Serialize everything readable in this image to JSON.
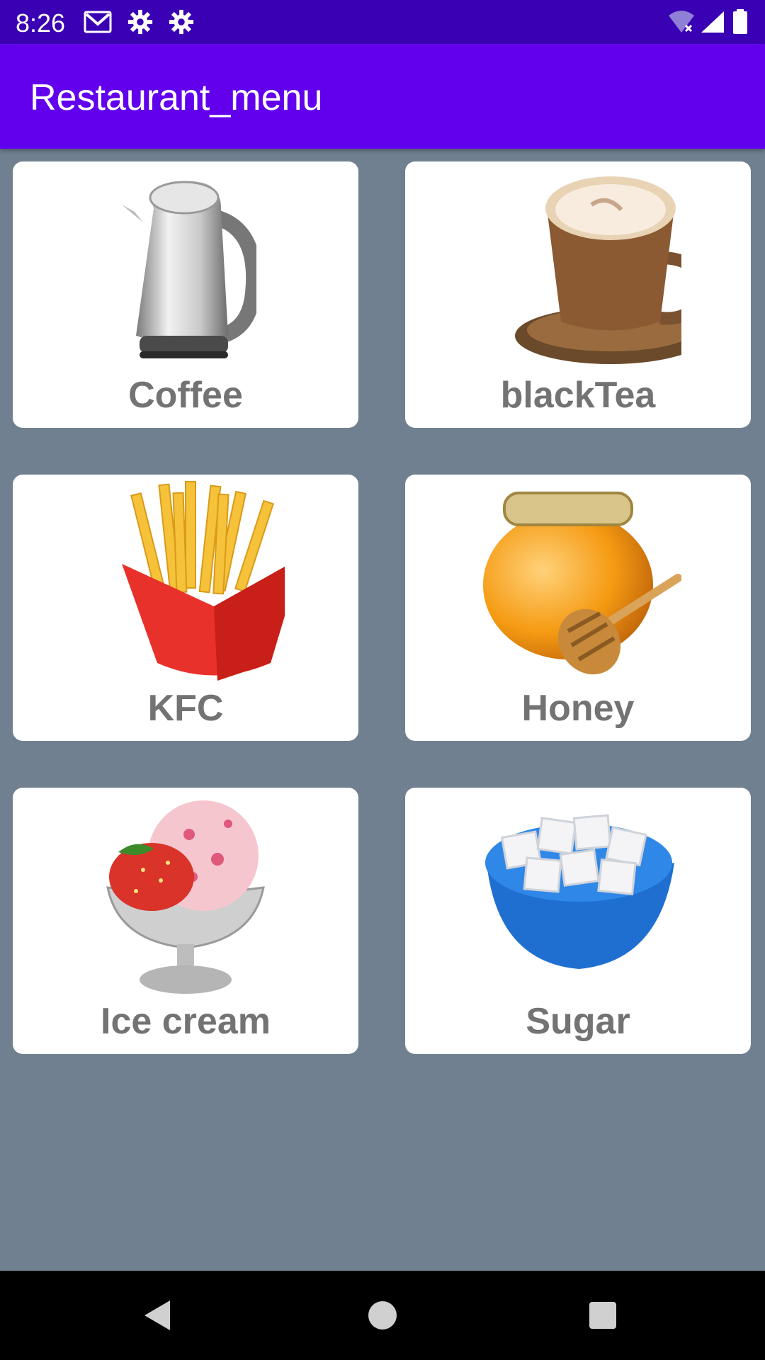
{
  "status_bar": {
    "time": "8:26",
    "icons": [
      "gmail-icon",
      "settings-icon",
      "settings-icon",
      "wifi-icon",
      "signal-icon",
      "battery-icon"
    ]
  },
  "app_bar": {
    "title": "Restaurant_menu",
    "color": "#6200ee"
  },
  "menu": {
    "items": [
      {
        "label": "Coffee",
        "icon": "kettle-icon"
      },
      {
        "label": "blackTea",
        "icon": "tea-cup-icon"
      },
      {
        "label": "KFC",
        "icon": "french-fries-icon"
      },
      {
        "label": "Honey",
        "icon": "honey-pot-icon"
      },
      {
        "label": "Ice cream",
        "icon": "ice-cream-icon"
      },
      {
        "label": "Sugar",
        "icon": "sugar-bowl-icon"
      }
    ]
  },
  "nav_bar": {
    "buttons": [
      "back-icon",
      "home-icon",
      "recents-icon"
    ]
  },
  "colors": {
    "background": "#708090",
    "card": "#ffffff",
    "label": "#737373",
    "status_bar": "#3a00b3"
  }
}
